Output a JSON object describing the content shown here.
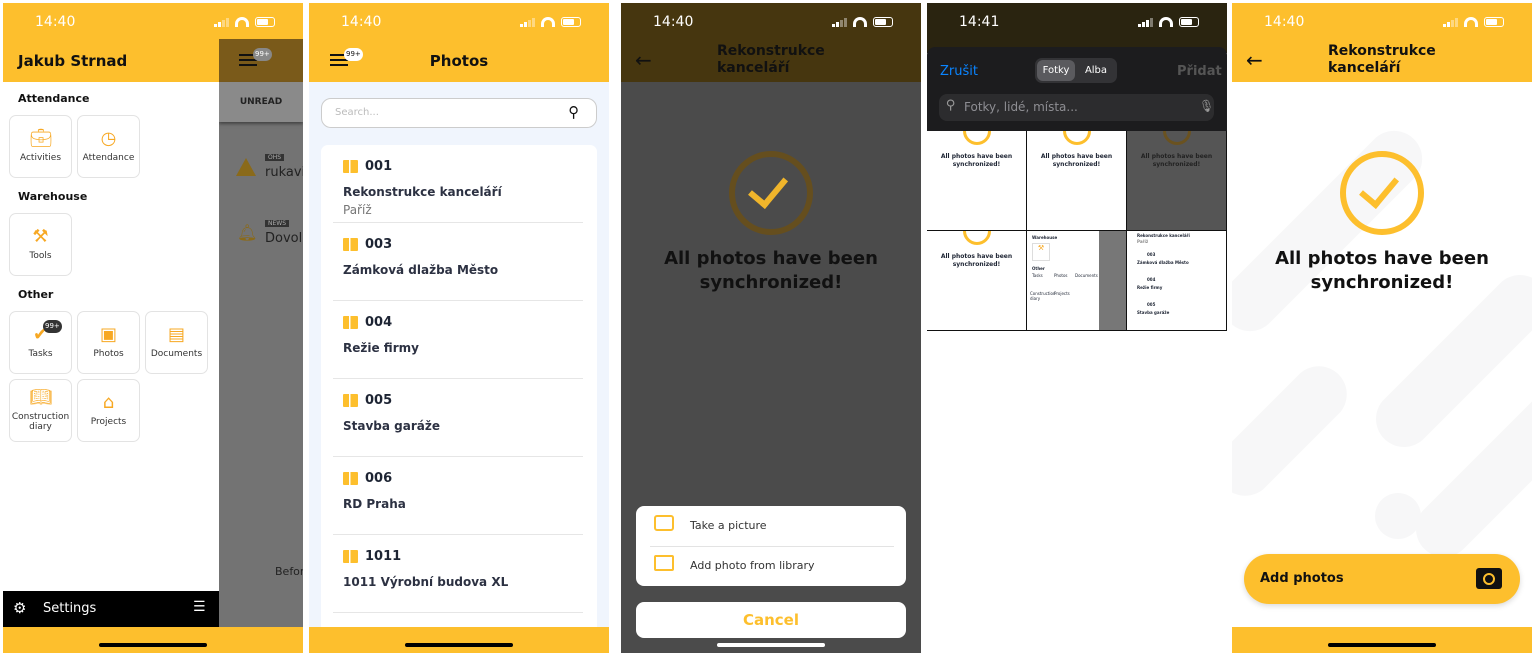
{
  "colors": {
    "brand_yellow": "#fdbf2d",
    "dark": "#000000",
    "ios_blue": "#0a84ff"
  },
  "panel1": {
    "time": "14:40",
    "user_name": "Jakub Strnad",
    "sections": [
      {
        "title": "Attendance",
        "items": [
          {
            "label": "Activities",
            "icon": "briefcase-icon"
          },
          {
            "label": "Attendance",
            "icon": "clock-icon"
          }
        ]
      },
      {
        "title": "Warehouse",
        "items": [
          {
            "label": "Tools",
            "icon": "tools-icon"
          }
        ]
      },
      {
        "title": "Other",
        "items": [
          {
            "label": "Tasks",
            "icon": "check-circle-icon",
            "badge": "99+"
          },
          {
            "label": "Photos",
            "icon": "image-icon"
          },
          {
            "label": "Documents",
            "icon": "document-icon"
          },
          {
            "label": "Construction diary",
            "icon": "book-icon"
          },
          {
            "label": "Projects",
            "icon": "projects-icon"
          }
        ]
      }
    ],
    "settings_label": "Settings",
    "background": {
      "menu_badge": "99+",
      "tab": "UNREAD",
      "items": [
        {
          "tag": "OHS",
          "text": "rukavic"
        },
        {
          "tag": "NEWS",
          "text": "Dovole"
        }
      ],
      "footer_text": "Befor"
    }
  },
  "panel2": {
    "time": "14:40",
    "menu_badge": "99+",
    "title": "Photos",
    "search_placeholder": "Search...",
    "projects": [
      {
        "code": "001",
        "name": "Rekonstrukce kanceláří",
        "location": "Paříž"
      },
      {
        "code": "003",
        "name": "Zámková dlažba Město"
      },
      {
        "code": "004",
        "name": "Režie firmy"
      },
      {
        "code": "005",
        "name": "Stavba garáže"
      },
      {
        "code": "006",
        "name": "RD Praha"
      },
      {
        "code": "1011",
        "name": "1011 Výrobní budova XL"
      }
    ]
  },
  "panel3": {
    "time": "14:40",
    "title": "Rekonstrukce kanceláří",
    "sync_message": "All photos have been synchronized!",
    "actions": [
      {
        "label": "Take a picture",
        "icon": "camera-icon"
      },
      {
        "label": "Add photo from library",
        "icon": "image-icon"
      }
    ],
    "cancel_label": "Cancel"
  },
  "panel4": {
    "time": "14:41",
    "cancel_label": "Zrušit",
    "segments": [
      "Fotky",
      "Alba"
    ],
    "active_segment": "Fotky",
    "add_label": "Přidat",
    "search_placeholder": "Fotky, lidé, místa...",
    "thumb_text": "All photos have been synchronized!",
    "thumb_menu": {
      "section1": "Warehouse",
      "tools": "Tools",
      "section2": "Other",
      "tasks": "Tasks",
      "photos": "Photos",
      "documents": "Documents",
      "diary": "Construction diary",
      "projects": "Projects"
    },
    "thumb_list": [
      {
        "name": "Rekonstrukce kanceláří",
        "loc": "Paříž"
      },
      {
        "code": "003",
        "name": "Zámková dlažba Město"
      },
      {
        "code": "004",
        "name": "Režie firmy"
      },
      {
        "code": "005",
        "name": "Stavba garáže"
      }
    ]
  },
  "panel5": {
    "time": "14:40",
    "title": "Rekonstrukce kanceláří",
    "sync_message": "All photos have been synchronized!",
    "add_photos_label": "Add photos"
  }
}
